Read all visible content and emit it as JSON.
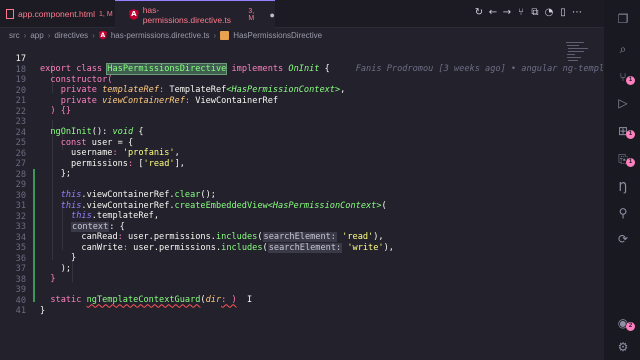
{
  "tabs": [
    {
      "name": "app.component.html",
      "status": "1, M"
    },
    {
      "name": "has-permissions.directive.ts",
      "status": "3, M",
      "active": true
    }
  ],
  "breadcrumb": [
    "src",
    "app",
    "directives",
    "has-permissions.directive.ts",
    "HasPermissionsDirective"
  ],
  "blame": "Fanis Prodromou [3 weeks ago] • angular ng-templ",
  "lines": {
    "n17": "17",
    "n18": "18",
    "n19": "19",
    "n20": "20",
    "n21": "21",
    "n22": "22",
    "n23": "23",
    "n24": "24",
    "n25": "25",
    "n26": "26",
    "n27": "27",
    "n28": "28",
    "n29": "29",
    "n30": "30",
    "n31": "31",
    "n32": "32",
    "n33": "33",
    "n34": "34",
    "n35": "35",
    "n36": "36",
    "n37": "37",
    "n38": "38",
    "n39": "39",
    "n40": "40",
    "n41": "41"
  },
  "code": {
    "export": "export",
    "class": "class",
    "class_name": "HasPermissionsDirective",
    "implements": "implements",
    "oninit": "OnInit",
    "brace_open": " {",
    "constructor": "constructor(",
    "private": "private",
    "templateRef": "templateRef",
    "colon": ":",
    "TemplateRef": "TemplateRef",
    "ctx_type": "<HasPermissionContext>",
    "comma": ",",
    "viewContainerRef": "viewContainerRef",
    "ViewContainerRef": "ViewContainerRef",
    "ctor_close": ") {}",
    "ngOnInit": "ngOnInit",
    "ngOnInit_sig": "(): ",
    "void": "void",
    "sig_brace": " {",
    "const": "const",
    "user_decl": " user = {",
    "username": "username",
    "username_val": "'profanis'",
    "permissions": "permissions",
    "perm_open": " [",
    "perm_read": "'read'",
    "perm_close": "],",
    "obj_close": "};",
    "this": "this",
    "clear_call": ".viewContainerRef.",
    "clear": "clear",
    "clear_tail": "();",
    "create_pre": ".viewContainerRef.",
    "createEmbeddedView": "createEmbeddedView",
    "create_generic": "<HasPermissionContext>",
    "paren_open": "(",
    "tref": ".templateRef,",
    "context": "context",
    "ctx_open": ": {",
    "canRead": "canRead",
    "canWrite": "canWrite",
    "user_perm": " user.permissions.",
    "includes": "includes",
    "searchElement": "searchElement:",
    "read": "'read'",
    "write": "'write'",
    "tail_read": "),",
    "tail_write": "),",
    "close_brace": "}",
    "close_paren": ");",
    "fn_close": "}",
    "static": "static",
    "guard": "ngTemplateContextGuard",
    "guard_sig": "(",
    "dir": "dir",
    "guard_tail": ": )",
    "cursor": "I",
    "class_close": "}"
  },
  "activity": {
    "badges": [
      "1",
      "1",
      "1",
      "2"
    ]
  }
}
